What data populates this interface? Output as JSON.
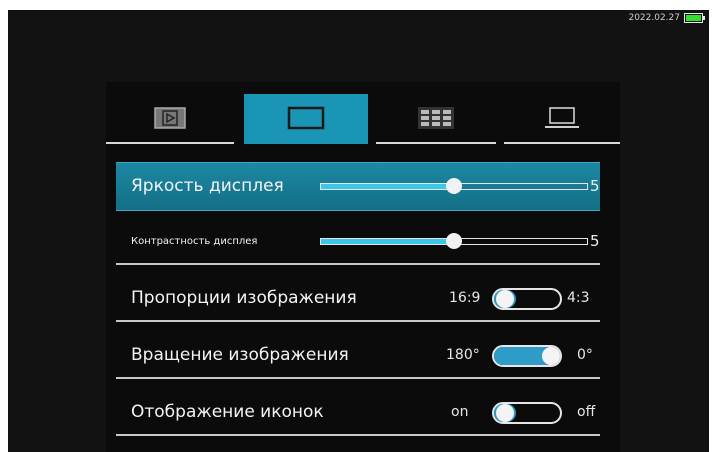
{
  "status": {
    "datetime": "2022.02.27",
    "battery_level": 1.0,
    "battery_color": "#31e031"
  },
  "tabs": [
    {
      "icon": "play-icon",
      "active": false
    },
    {
      "icon": "display-icon",
      "active": true
    },
    {
      "icon": "grid-icon",
      "active": false
    },
    {
      "icon": "laptop-icon",
      "active": false
    }
  ],
  "settings": {
    "brightness": {
      "label": "Яркость дисплея",
      "value": "5",
      "level": 0.5
    },
    "contrast": {
      "label": "Контрастность дисплея",
      "value": "5",
      "level": 0.5
    },
    "aspect": {
      "label": "Пропорции изображения",
      "option_left": "16:9",
      "option_right": "4:3",
      "selected": "16:9"
    },
    "rotation": {
      "label": "Вращение изображения",
      "option_left": "180°",
      "option_right": "0°",
      "selected": "0°"
    },
    "icons": {
      "label": "Отображение иконок",
      "option_left": "on",
      "option_right": "off",
      "selected": "on"
    }
  },
  "colors": {
    "accent": "#1a95b5",
    "slider_fill": "#3bc7e8"
  }
}
